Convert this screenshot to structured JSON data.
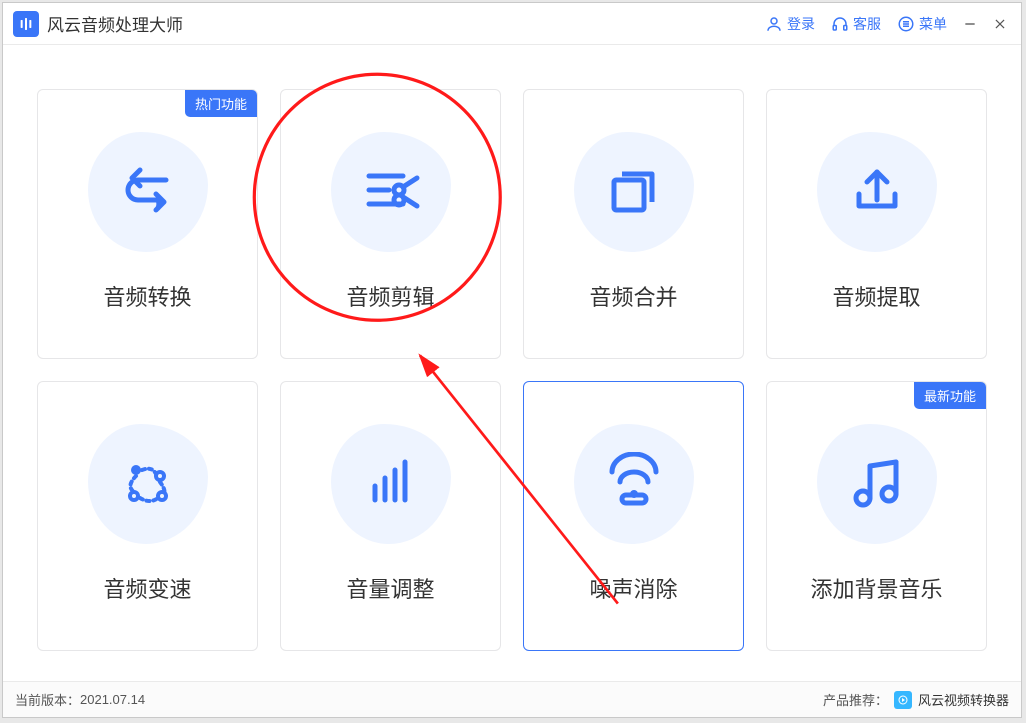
{
  "app": {
    "title": "风云音频处理大师"
  },
  "titlebar": {
    "login": "登录",
    "support": "客服",
    "menu": "菜单"
  },
  "badges": {
    "hot": "热门功能",
    "new": "最新功能"
  },
  "cards": {
    "convert": "音频转换",
    "cut": "音频剪辑",
    "merge": "音频合并",
    "extract": "音频提取",
    "speed": "音频变速",
    "volume": "音量调整",
    "denoise": "噪声消除",
    "bgm": "添加背景音乐"
  },
  "footer": {
    "version_label": "当前版本：",
    "version_value": "2021.07.14",
    "recommend_label": "产品推荐：",
    "recommend_product": "风云视频转换器"
  },
  "colors": {
    "accent": "#3a76f8"
  }
}
